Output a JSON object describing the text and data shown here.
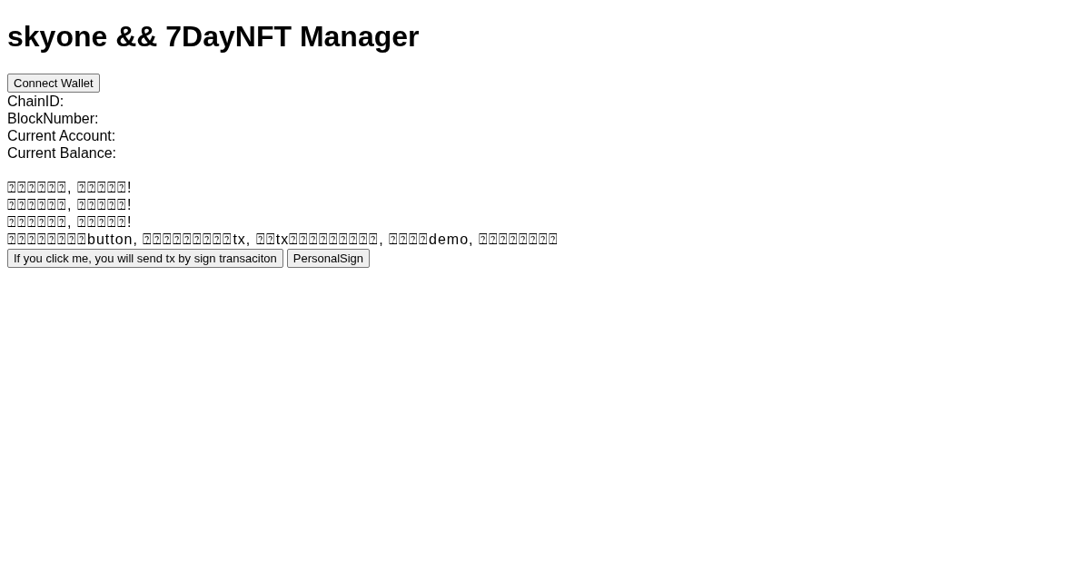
{
  "page": {
    "title": "skyone && 7DayNFT Manager"
  },
  "connect_button": "Connect Wallet",
  "fields": [
    {
      "label": "ChainID:"
    },
    {
      "label": "BlockNumber:"
    },
    {
      "label": "Current Account:"
    },
    {
      "label": "Current Balance:"
    }
  ],
  "messages": [
    "⍰⍰⍰⍰⍰⍰, ⍰⍰⍰⍰⍰!",
    "⍰⍰⍰⍰⍰⍰, ⍰⍰⍰⍰⍰!",
    "⍰⍰⍰⍰⍰⍰, ⍰⍰⍰⍰⍰!",
    "⍰⍰⍰⍰⍰⍰⍰⍰button, ⍰⍰⍰⍰⍰⍰⍰⍰⍰tx, ⍰⍰tx⍰⍰⍰⍰⍰⍰⍰⍰⍰, ⍰⍰⍰⍰demo, ⍰⍰⍰⍰⍰⍰⍰⍰"
  ],
  "buttons": [
    "If you click me, you will send tx by sign transaciton",
    "PersonalSign"
  ]
}
